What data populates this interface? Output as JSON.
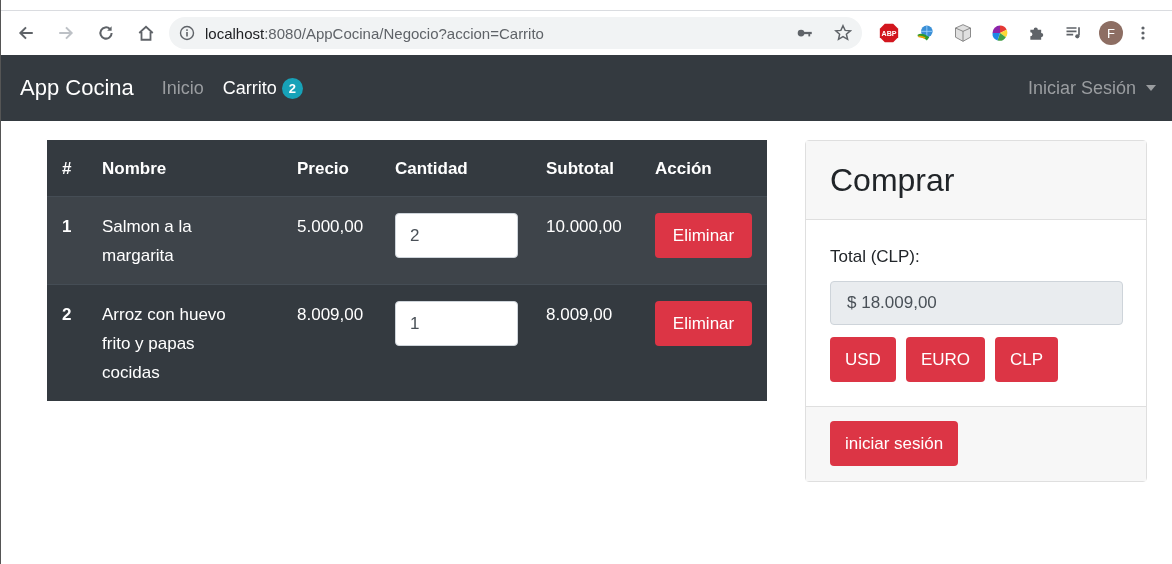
{
  "browser": {
    "url_host": "localhost",
    "url_rest": ":8080/AppCocina/Negocio?accion=Carrito",
    "extension_badge": "ABP",
    "profile_initial": "F"
  },
  "navbar": {
    "brand": "App Cocina",
    "links": [
      {
        "label": "Inicio",
        "selected": false
      },
      {
        "label": "Carrito",
        "selected": true,
        "badge": "2"
      }
    ],
    "login_menu": "Iniciar Sesión"
  },
  "table": {
    "columns": [
      "#",
      "Nombre",
      "Precio",
      "Cantidad",
      "Subtotal",
      "Acción"
    ],
    "rows": [
      {
        "index": "1",
        "name": "Salmon a la margarita",
        "price": "5.000,00",
        "quantity": "2",
        "subtotal": "10.000,00",
        "action": "Eliminar"
      },
      {
        "index": "2",
        "name": "Arroz con huevo frito y papas cocidas",
        "price": "8.009,00",
        "quantity": "1",
        "subtotal": "8.009,00",
        "action": "Eliminar"
      }
    ]
  },
  "purchase_card": {
    "title": "Comprar",
    "total_label": "Total (CLP):",
    "total_value": "$ 18.009,00",
    "currency_buttons": [
      "USD",
      "EURO",
      "CLP"
    ],
    "footer_button": "iniciar sesión"
  }
}
